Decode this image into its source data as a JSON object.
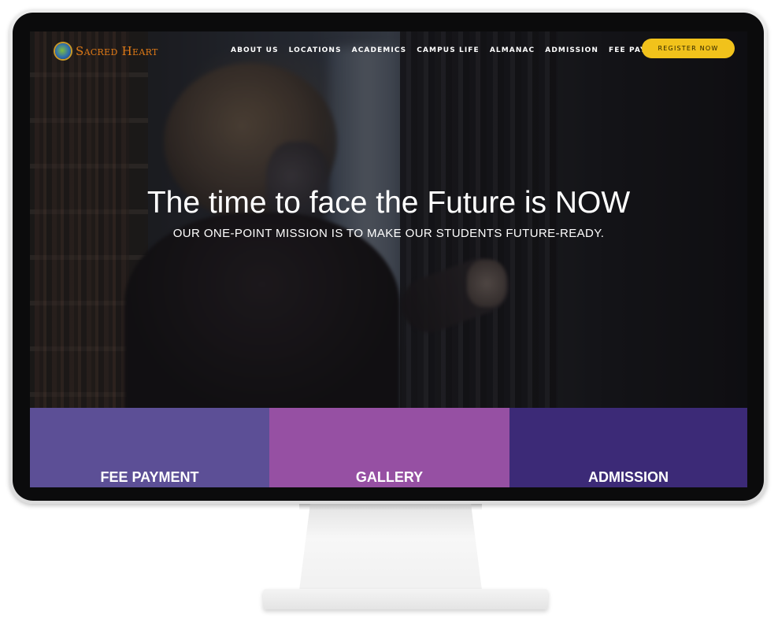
{
  "site": {
    "logo_text": "Sacred Heart"
  },
  "nav": {
    "items": [
      {
        "label": "ABOUT US"
      },
      {
        "label": "LOCATIONS"
      },
      {
        "label": "ACADEMICS"
      },
      {
        "label": "CAMPUS LIFE"
      },
      {
        "label": "ALMANAC"
      },
      {
        "label": "ADMISSION"
      },
      {
        "label": "FEE PAYMENT"
      }
    ],
    "register_label": "REGISTER NOW"
  },
  "hero": {
    "title": "The time to face the Future is NOW",
    "subtitle": "OUR ONE-POINT MISSION IS TO MAKE OUR STUDENTS FUTURE-READY."
  },
  "tiles": [
    {
      "label": "FEE PAYMENT",
      "color": "#5c4f96"
    },
    {
      "label": "GALLERY",
      "color": "#9650a3"
    },
    {
      "label": "ADMISSION",
      "color": "#3c2a77"
    }
  ],
  "colors": {
    "accent": "#f1c21b",
    "logo": "#e07a16"
  }
}
